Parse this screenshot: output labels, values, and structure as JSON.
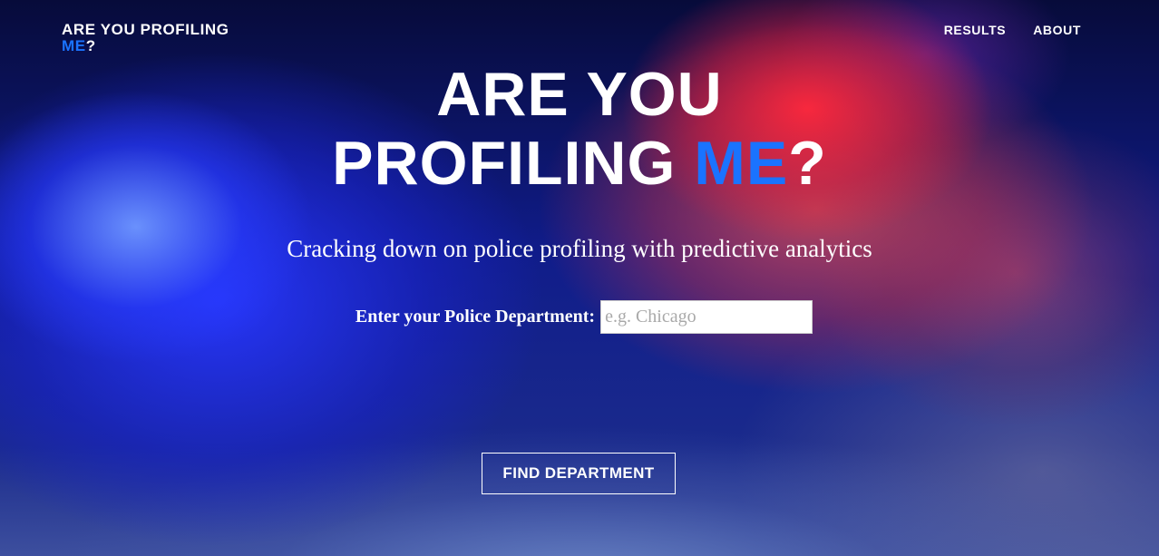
{
  "header": {
    "logo_line1": "ARE YOU PROFILING",
    "logo_accent": "ME",
    "logo_suffix": "?",
    "nav": [
      {
        "label": "RESULTS"
      },
      {
        "label": "ABOUT"
      }
    ]
  },
  "hero": {
    "title_line1": "ARE YOU",
    "title_line2_prefix": "PROFILING ",
    "title_accent": "ME",
    "title_suffix": "?",
    "tagline": "Cracking down on police profiling with predictive analytics"
  },
  "search": {
    "label": "Enter your Police Department:",
    "value": "",
    "placeholder": "e.g. Chicago",
    "button_label": "FIND DEPARTMENT"
  },
  "colors": {
    "accent": "#1a73ff",
    "text": "#ffffff"
  }
}
